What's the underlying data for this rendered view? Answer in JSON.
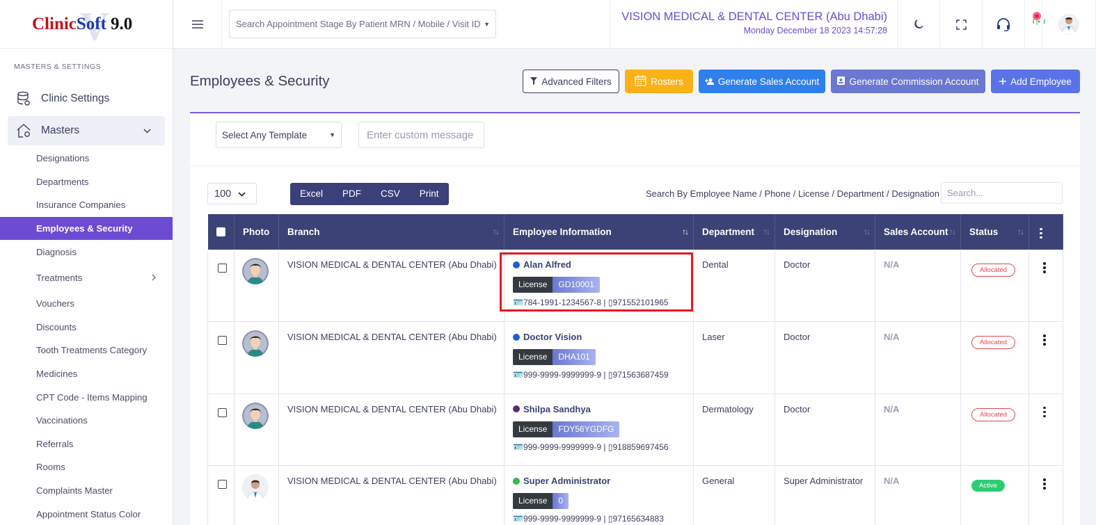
{
  "logo": {
    "clinic": "Clinic",
    "soft": "Soft",
    "version": "9.0",
    "watermark": "V"
  },
  "sidebar": {
    "section_title": "MASTERS & SETTINGS",
    "clinic_settings": "Clinic Settings",
    "masters": "Masters",
    "items": [
      {
        "label": "Designations"
      },
      {
        "label": "Departments"
      },
      {
        "label": "Insurance Companies"
      },
      {
        "label": "Employees & Security",
        "active": true
      },
      {
        "label": "Diagnosis"
      },
      {
        "label": "Treatments",
        "has_submenu": true
      },
      {
        "label": "Vouchers"
      },
      {
        "label": "Discounts"
      },
      {
        "label": "Tooth Treatments Category"
      },
      {
        "label": "Medicines"
      },
      {
        "label": "CPT Code - Items Mapping"
      },
      {
        "label": "Vaccinations"
      },
      {
        "label": "Referrals"
      },
      {
        "label": "Rooms"
      },
      {
        "label": "Complaints Master"
      },
      {
        "label": "Appointment Status Color"
      }
    ],
    "accent": "#6c4bd2"
  },
  "topbar": {
    "search_placeholder": "Search Appointment Stage By Patient MRN / Mobile / Visit ID",
    "clinic_name": "VISION MEDICAL & DENTAL CENTER (Abu Dhabi)",
    "datetime": "Monday December 18 2023 14:57:28",
    "icons": [
      "moon-icon",
      "fullscreen-icon",
      "headset-icon",
      "location-signal-icon",
      "user-avatar"
    ]
  },
  "page": {
    "title": "Employees & Security",
    "buttons": {
      "advanced_filters": "Advanced Filters",
      "rosters": "Rosters",
      "generate_sales": "Generate Sales Account",
      "generate_commission": "Generate Commission Account",
      "add_employee": "Add Employee"
    }
  },
  "template": {
    "select_value": "Select Any Template",
    "message_placeholder": "Enter custom message"
  },
  "table_controls": {
    "page_length": "100",
    "export": [
      "Excel",
      "PDF",
      "CSV",
      "Print"
    ],
    "search_label": "Search By Employee Name / Phone / License / Department / Designation",
    "search_placeholder": "Search..."
  },
  "table": {
    "headers": [
      "",
      "Photo",
      "Branch",
      "Employee Information",
      "Department",
      "Designation",
      "Sales Account",
      "Status",
      ""
    ],
    "license_label": "License",
    "rows": [
      {
        "branch": "VISION MEDICAL & DENTAL CENTER (Abu Dhabi)",
        "name": "Alan Alfred",
        "dot_color": "#1a5fd8",
        "license": "GD10001",
        "emirates_id": "784-1991-1234567-8",
        "phone": "971552101965",
        "department": "Dental",
        "designation": "Doctor",
        "sales_account": "N/A",
        "status": "Allocated",
        "avatar": "cartoon"
      },
      {
        "branch": "VISION MEDICAL & DENTAL CENTER (Abu Dhabi)",
        "name": "Doctor Vision",
        "dot_color": "#1a5fd8",
        "license": "DHA101",
        "emirates_id": "999-9999-9999999-9",
        "phone": "971563687459",
        "department": "Laser",
        "designation": "Doctor",
        "sales_account": "N/A",
        "status": "Allocated",
        "avatar": "cartoon"
      },
      {
        "branch": "VISION MEDICAL & DENTAL CENTER (Abu Dhabi)",
        "name": "Shilpa Sandhya",
        "dot_color": "#5a2a6e",
        "license": "FDY56YGDFG",
        "emirates_id": "999-9999-9999999-9",
        "phone": "918859697456",
        "department": "Dermatology",
        "designation": "Doctor",
        "sales_account": "N/A",
        "status": "Allocated",
        "avatar": "cartoon"
      },
      {
        "branch": "VISION MEDICAL & DENTAL CENTER (Abu Dhabi)",
        "name": "Super Administrator",
        "dot_color": "#2ebd4a",
        "license": "0",
        "emirates_id": "999-9999-9999999-9",
        "phone": "97165634883",
        "department": "General",
        "designation": "Super Administrator",
        "sales_account": "N/A",
        "status": "Active",
        "avatar": "doctor"
      }
    ]
  }
}
